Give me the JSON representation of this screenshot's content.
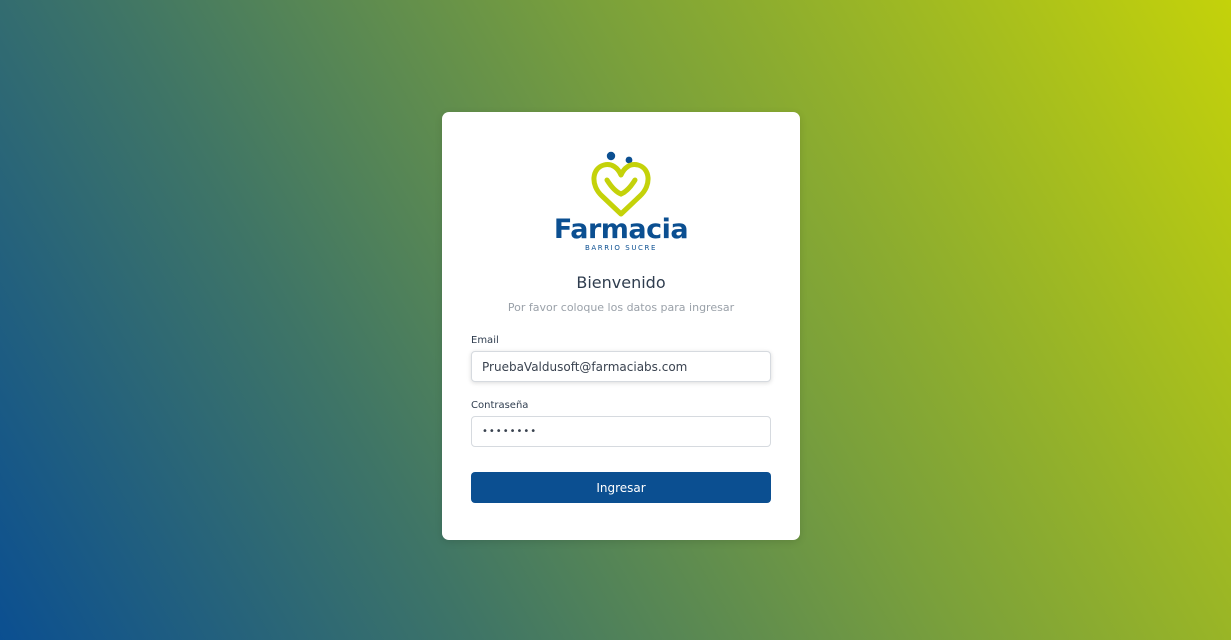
{
  "brand": {
    "name": "Farmacia",
    "tagline": "BARRIO SUCRE",
    "colors": {
      "primary": "#0b4f91",
      "accent": "#c4d20a"
    }
  },
  "login": {
    "title": "Bienvenido",
    "subtitle": "Por favor coloque los datos para ingresar",
    "email": {
      "label": "Email",
      "value": "PruebaValdusoft@farmaciabs.com"
    },
    "password": {
      "label": "Contraseña",
      "value": "••••••••"
    },
    "submit_label": "Ingresar"
  }
}
